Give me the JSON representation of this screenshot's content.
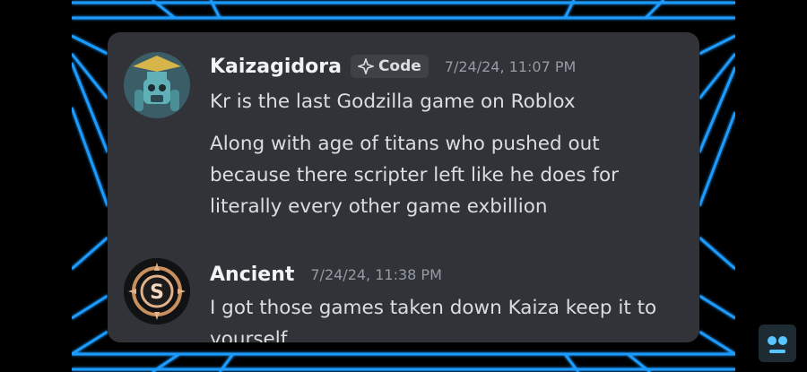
{
  "messages": [
    {
      "username": "Kaizagidora",
      "tag": "Code",
      "timestamp": "7/24/24, 11:07 PM",
      "lines": [
        "Kr is the last Godzilla game on Roblox",
        "Along with age of titans who pushed out because there scripter left like he does for literally every other game exbillion"
      ]
    },
    {
      "username": "Ancient",
      "timestamp": "7/24/24, 11:38 PM",
      "lines": [
        "I got those games taken down Kaiza keep it to yourself"
      ]
    }
  ],
  "colors": {
    "card_bg": "#313338",
    "username": "#f2f3f5",
    "text": "#dbdee1",
    "timestamp": "#949ba4",
    "grid": "#1e9bff"
  }
}
